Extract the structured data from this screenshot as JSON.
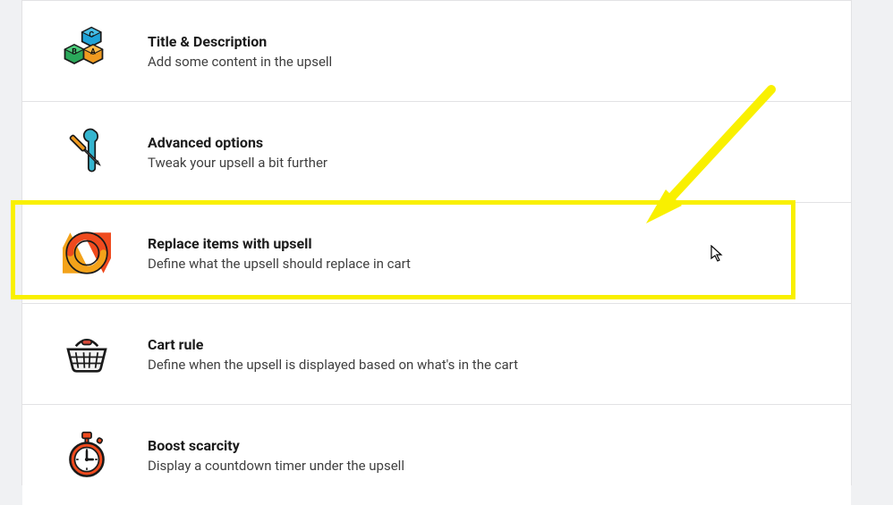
{
  "items": [
    {
      "title": "Title & Description",
      "desc": "Add some content in the upsell"
    },
    {
      "title": "Advanced options",
      "desc": "Tweak your upsell a bit further"
    },
    {
      "title": "Replace items with upsell",
      "desc": "Define what the upsell should replace in cart"
    },
    {
      "title": "Cart rule",
      "desc": "Define when the upsell is displayed based on what's in the cart"
    },
    {
      "title": "Boost scarcity",
      "desc": "Display a countdown timer under the upsell"
    }
  ],
  "colors": {
    "highlight": "#f9f000"
  }
}
